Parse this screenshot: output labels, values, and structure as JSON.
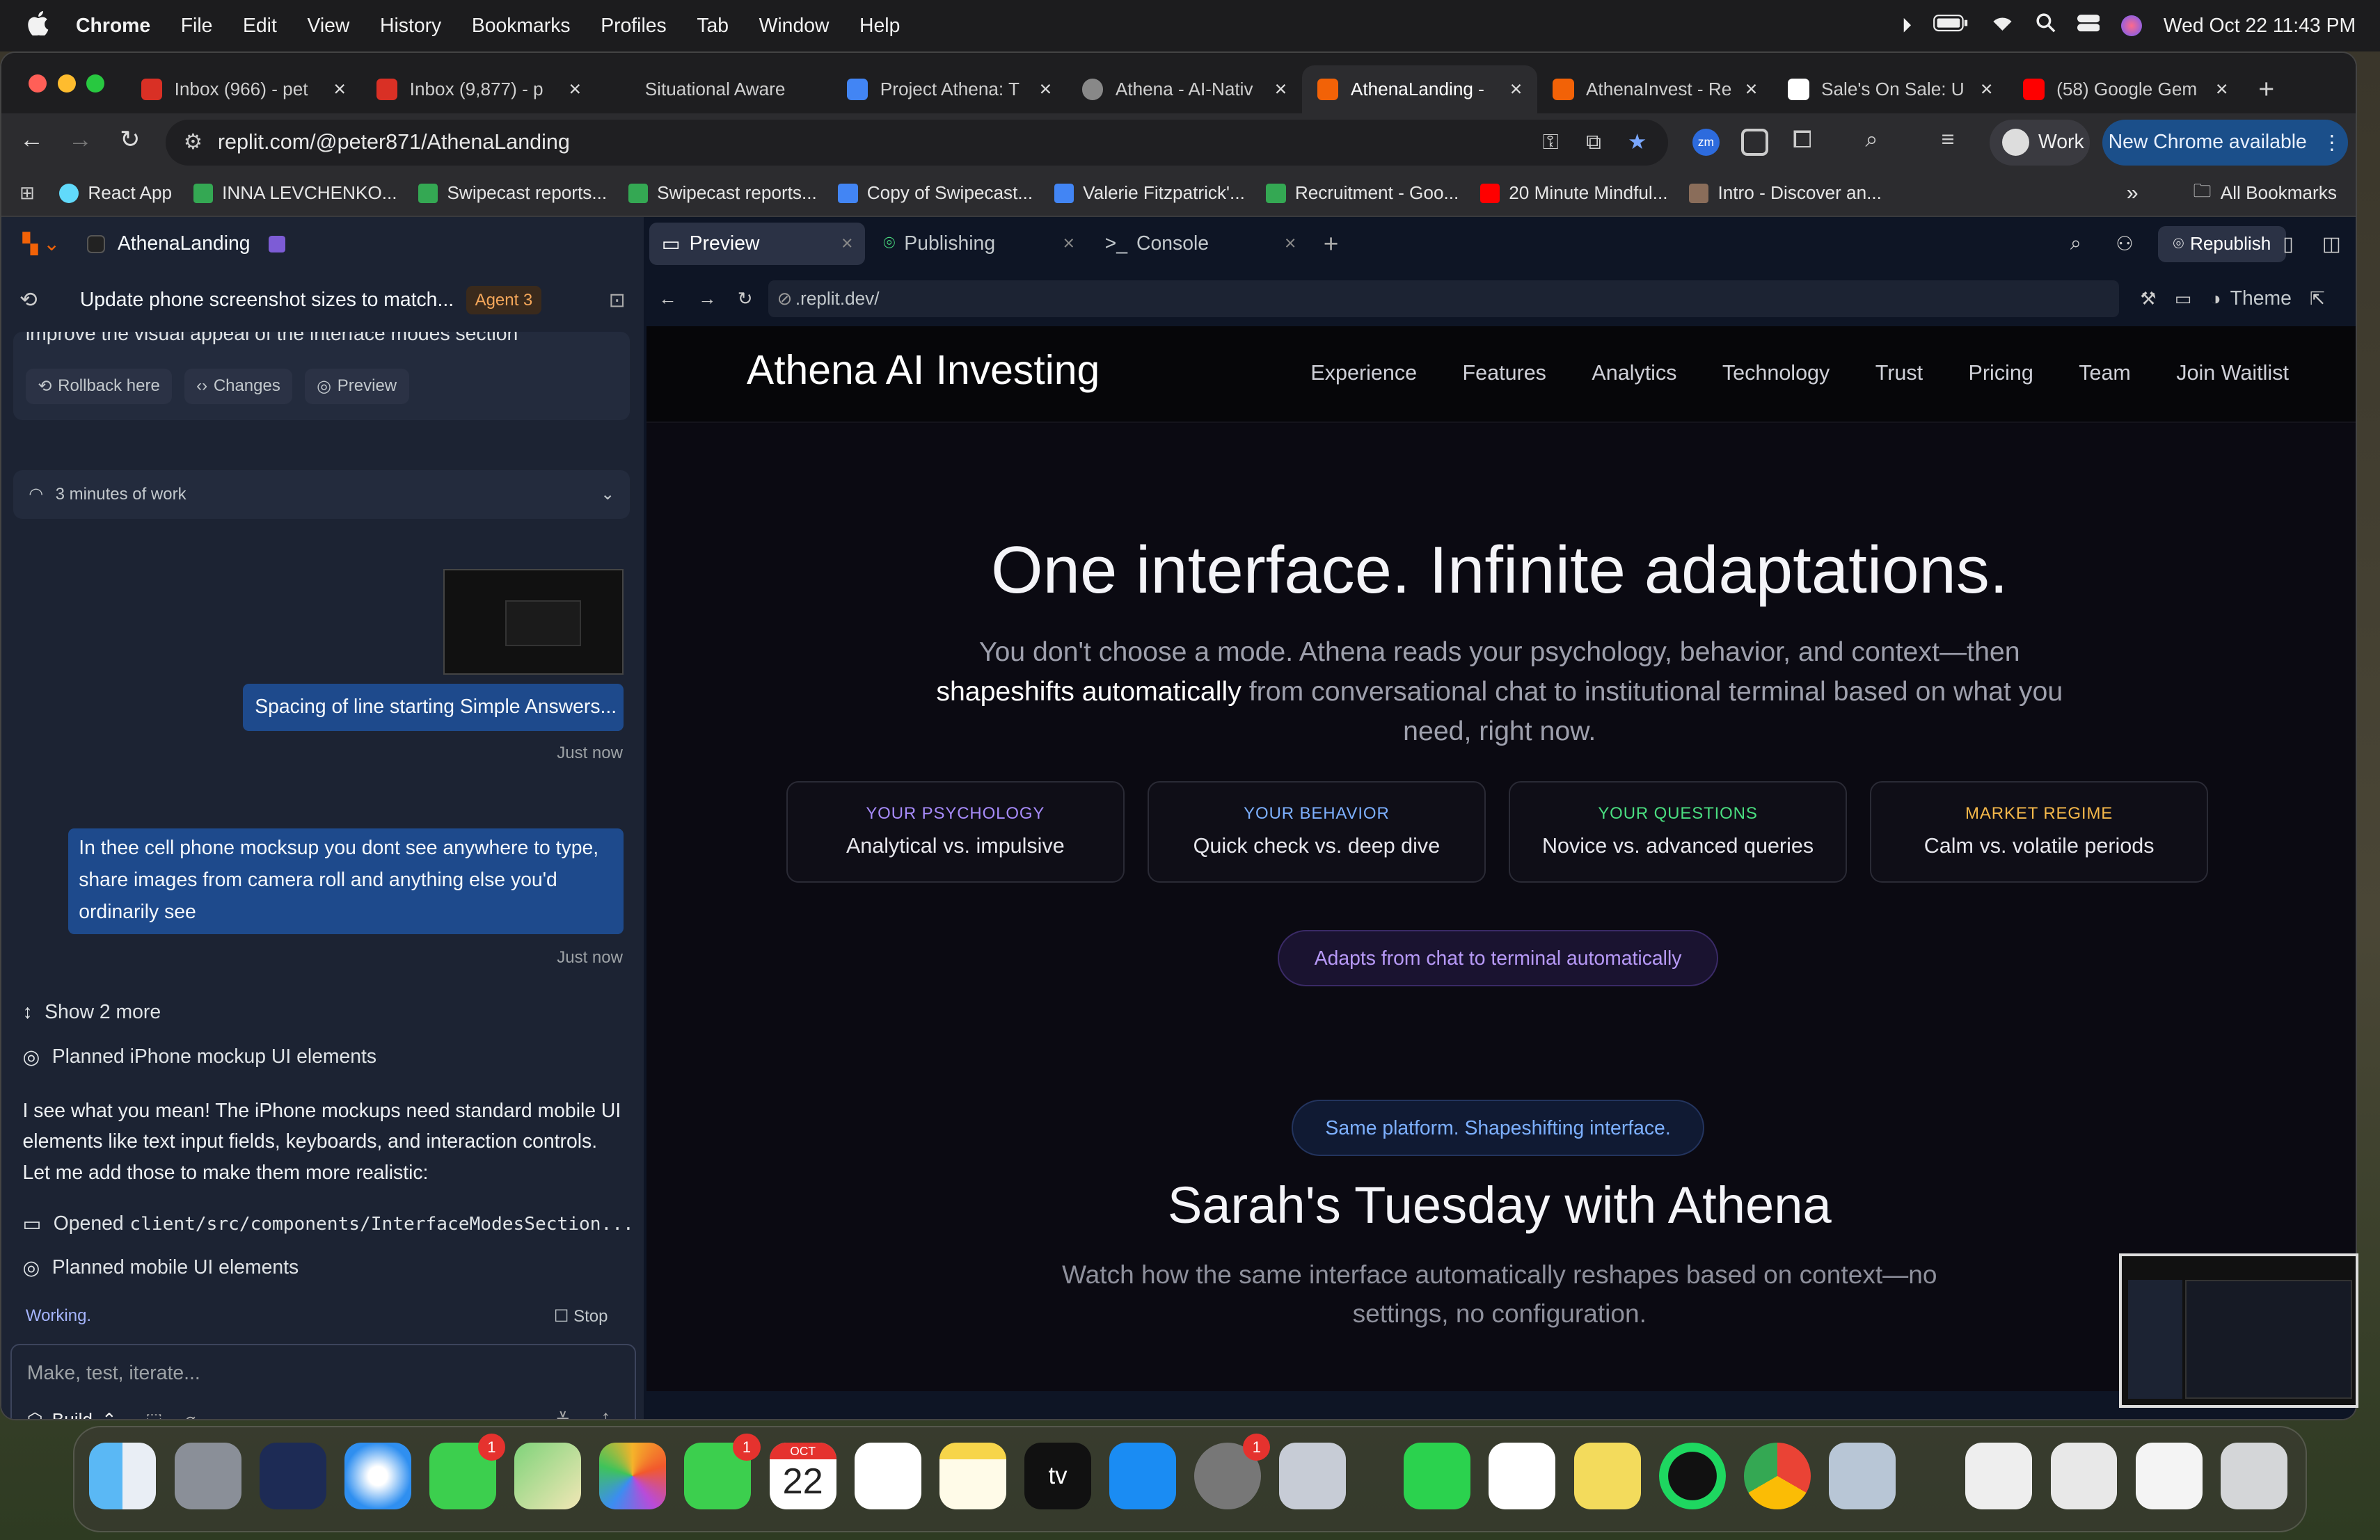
{
  "menubar": {
    "apple": "",
    "app_name": "Chrome",
    "items": [
      "File",
      "Edit",
      "View",
      "History",
      "Bookmarks",
      "Profiles",
      "Tab",
      "Window",
      "Help"
    ],
    "datetime": "Wed Oct 22  11:43 PM"
  },
  "tabs": [
    {
      "title": "Inbox (966) - pet",
      "icon": "gmail-icon",
      "color": "#d93025"
    },
    {
      "title": "Inbox (9,877) - p",
      "icon": "gmail-icon",
      "color": "#d93025"
    },
    {
      "title": "Situational Aware",
      "icon": "blank",
      "color": "#2c2c2f"
    },
    {
      "title": "Project Athena: T",
      "icon": "docs-icon",
      "color": "#4285f4"
    },
    {
      "title": "Athena - AI-Nativ",
      "icon": "globe-icon",
      "color": "#888888"
    },
    {
      "title": "AthenaLanding -",
      "icon": "replit-icon",
      "color": "#f26207"
    },
    {
      "title": "AthenaInvest - Re",
      "icon": "replit-icon",
      "color": "#f26207"
    },
    {
      "title": "Sale's On Sale: U",
      "icon": "sos-icon",
      "color": "#ffffff"
    },
    {
      "title": "(58) Google Gem",
      "icon": "youtube-icon",
      "color": "#ff0000"
    }
  ],
  "new_tab": "+",
  "address": {
    "url": "replit.com/@peter871/AthenaLanding",
    "profile": "Work",
    "update_button": "New Chrome available"
  },
  "bookmarks": [
    {
      "label": "React App",
      "color": "#61dafb"
    },
    {
      "label": "INNA LEVCHENKO...",
      "color": "#34a853"
    },
    {
      "label": "Swipecast reports...",
      "color": "#34a853"
    },
    {
      "label": "Swipecast reports...",
      "color": "#34a853"
    },
    {
      "label": "Copy of Swipecast...",
      "color": "#4285f4"
    },
    {
      "label": "Valerie Fitzpatrick'...",
      "color": "#4285f4"
    },
    {
      "label": "Recruitment - Goo...",
      "color": "#34a853"
    },
    {
      "label": "20 Minute Mindful...",
      "color": "#ff0000"
    },
    {
      "label": "Intro - Discover an...",
      "color": "#8a6d5a"
    }
  ],
  "bookmarks_more": "»",
  "all_bookmarks": "All Bookmarks",
  "replit": {
    "project": "AthenaLanding",
    "chat_title": "Update phone screenshot sizes to match...",
    "agent_badge": "Agent 3",
    "prev_message_tail": "improve the visual appeal of the interface modes section",
    "actions": [
      "Rollback here",
      "Changes",
      "Preview"
    ],
    "work_summary": "3 minutes of work",
    "msg1": "Spacing of line starting Simple Answers...",
    "msg1_time": "Just now",
    "msg2": "In thee cell phone mocksup you dont see anywhere to type, share images from camera roll and anything else you'd ordinarily see",
    "msg2_time": "Just now",
    "show_more": "Show 2 more",
    "step1": "Planned iPhone mockup UI elements",
    "agent_reply": "I see what you mean! The iPhone mockups need standard mobile UI elements like text input fields, keyboards, and interaction controls. Let me add those to make them more realistic:",
    "step2_prefix": "Opened",
    "step2_path": "client/src/components/InterfaceModesSection...",
    "step3": "Planned mobile UI elements",
    "status": "Working.",
    "stop": "Stop",
    "input_placeholder": "Make, test, iterate...",
    "build": "Build"
  },
  "preview": {
    "tabs": [
      "Preview",
      "Publishing",
      "Console"
    ],
    "add": "+",
    "republish": "Republish",
    "url": ".replit.dev/",
    "theme": "Theme"
  },
  "site": {
    "brand": "Athena AI Investing",
    "nav": [
      "Experience",
      "Features",
      "Analytics",
      "Technology",
      "Trust",
      "Pricing",
      "Team",
      "Join Waitlist"
    ],
    "headline": "One interface. Infinite adaptations.",
    "sub_a": "You don't choose a mode. Athena reads your psychology, behavior, and context—then",
    "sub_b_hl": "shapeshifts automatically",
    "sub_b_rest": " from conversational chat to institutional terminal based on what you",
    "sub_c": "need, right now.",
    "cards": [
      {
        "k": "YOUR PSYCHOLOGY",
        "v": "Analytical vs. impulsive",
        "color": "#9d7cf0"
      },
      {
        "k": "YOUR BEHAVIOR",
        "v": "Quick check vs. deep dive",
        "color": "#6ea8ff"
      },
      {
        "k": "YOUR QUESTIONS",
        "v": "Novice vs. advanced queries",
        "color": "#4ade80"
      },
      {
        "k": "MARKET REGIME",
        "v": "Calm vs. volatile periods",
        "color": "#f5b84a"
      }
    ],
    "pill1": "Adapts from chat to terminal automatically",
    "pill2": "Same platform. Shapeshifting interface.",
    "section_title": "Sarah's Tuesday with Athena",
    "section_sub_a": "Watch how the same interface automatically reshapes based on context—no",
    "section_sub_b": "settings, no configuration."
  },
  "dock": {
    "calendar_month": "OCT",
    "calendar_day": "22",
    "tv_label": "tv",
    "messages_badge": "1",
    "facetime_badge": "1",
    "settings_badge": "1"
  }
}
